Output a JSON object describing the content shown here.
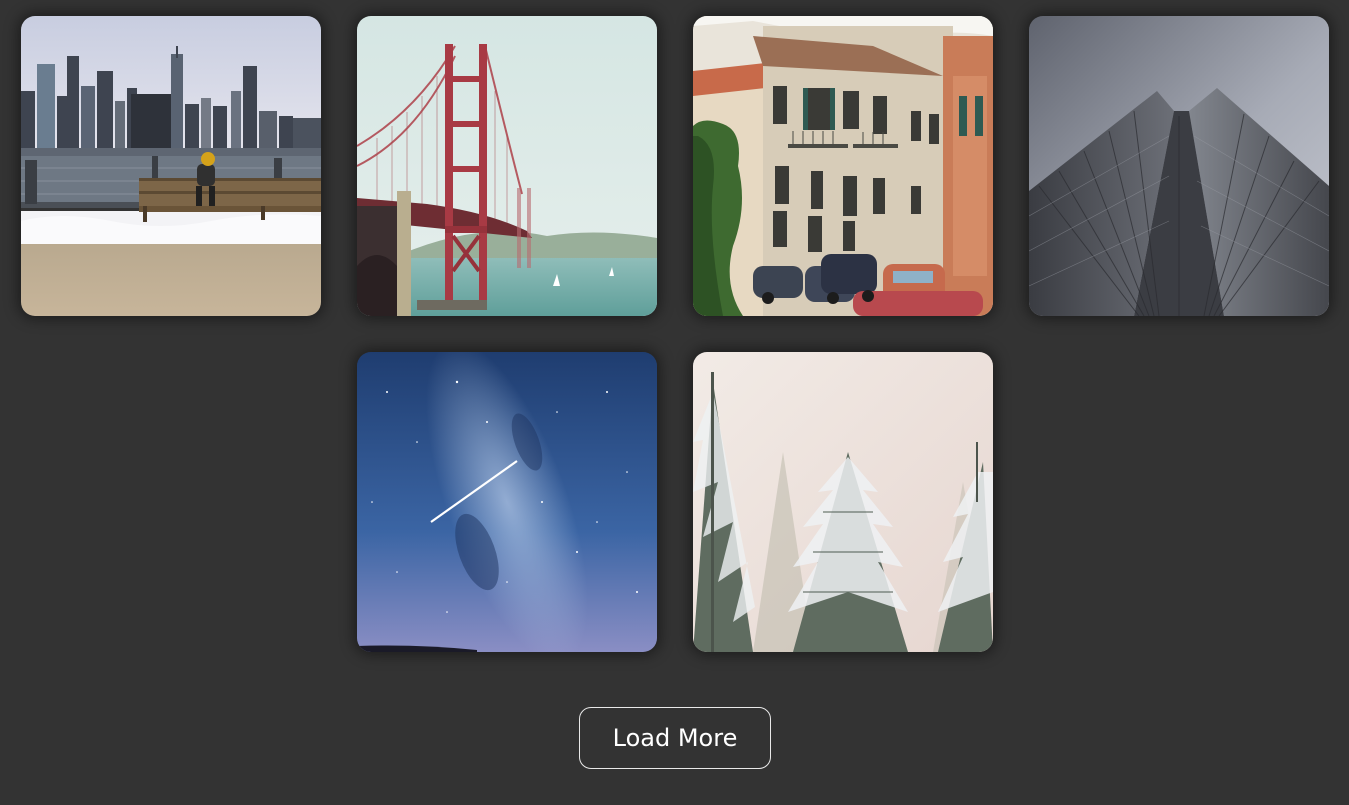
{
  "gallery": {
    "photos": [
      {
        "subject": "city-skyline-bench"
      },
      {
        "subject": "golden-gate-bridge"
      },
      {
        "subject": "old-town-street"
      },
      {
        "subject": "skyscraper-looking-up"
      },
      {
        "subject": "milky-way-shooting-star"
      },
      {
        "subject": "snowy-fir-trees"
      }
    ]
  },
  "actions": {
    "load_more_label": "Load More"
  },
  "colors": {
    "background": "#333333",
    "button_border": "#e9e9e9",
    "button_text": "#ffffff"
  }
}
